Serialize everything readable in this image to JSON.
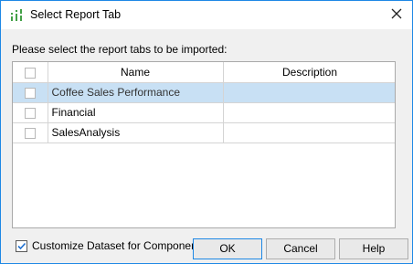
{
  "window": {
    "title": "Select Report Tab",
    "icon": "report-app-icon",
    "close_icon": "close-icon"
  },
  "prompt": "Please select the report tabs to be imported:",
  "table": {
    "columns": [
      "",
      "Name",
      "Description"
    ],
    "rows": [
      {
        "checked": false,
        "name": "Coffee Sales Performance",
        "description": "",
        "selected": true
      },
      {
        "checked": false,
        "name": "Financial",
        "description": "",
        "selected": false
      },
      {
        "checked": false,
        "name": "SalesAnalysis",
        "description": "",
        "selected": false
      }
    ]
  },
  "options": {
    "customize_dataset": {
      "label": "Customize Dataset for Components",
      "checked": true
    }
  },
  "buttons": {
    "ok": "OK",
    "cancel": "Cancel",
    "help": "Help"
  },
  "colors": {
    "accent": "#1e88e5",
    "selection": "#c8e0f4",
    "icon_green": "#43a047"
  }
}
